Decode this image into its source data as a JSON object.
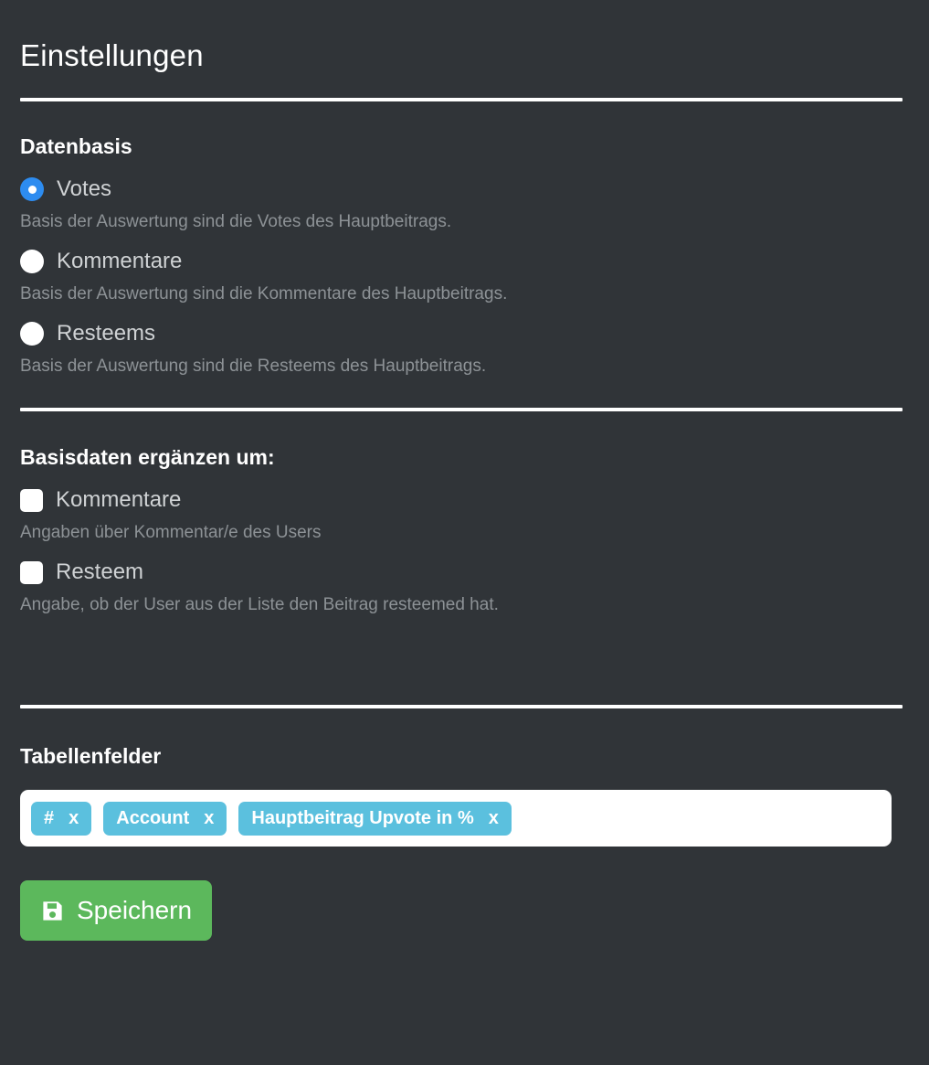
{
  "page": {
    "title": "Einstellungen"
  },
  "colors": {
    "background": "#303438",
    "accent_radio": "#2d8cf0",
    "tag": "#5bc0de",
    "save_button": "#5cb85c",
    "divider": "#ffffff",
    "label_text": "#cfd2d4",
    "description_text": "#8d9296"
  },
  "datenbasis": {
    "heading": "Datenbasis",
    "options": [
      {
        "label": "Votes",
        "description": "Basis der Auswertung sind die Votes des Hauptbeitrags.",
        "selected": true
      },
      {
        "label": "Kommentare",
        "description": "Basis der Auswertung sind die Kommentare des Hauptbeitrags.",
        "selected": false
      },
      {
        "label": "Resteems",
        "description": "Basis der Auswertung sind die Resteems des Hauptbeitrags.",
        "selected": false
      }
    ]
  },
  "basisdaten": {
    "heading": "Basisdaten ergänzen um:",
    "options": [
      {
        "label": "Kommentare",
        "description": "Angaben über Kommentar/e des Users",
        "checked": false
      },
      {
        "label": "Resteem",
        "description": "Angabe, ob der User aus der Liste den Beitrag resteemed hat.",
        "checked": false
      }
    ]
  },
  "tabellenfelder": {
    "heading": "Tabellenfelder",
    "tags": [
      {
        "label": "#",
        "remove": "x"
      },
      {
        "label": "Account",
        "remove": "x"
      },
      {
        "label": "Hauptbeitrag Upvote in %",
        "remove": "x"
      }
    ]
  },
  "actions": {
    "save_label": "Speichern",
    "save_icon": "floppy-disk-icon"
  }
}
